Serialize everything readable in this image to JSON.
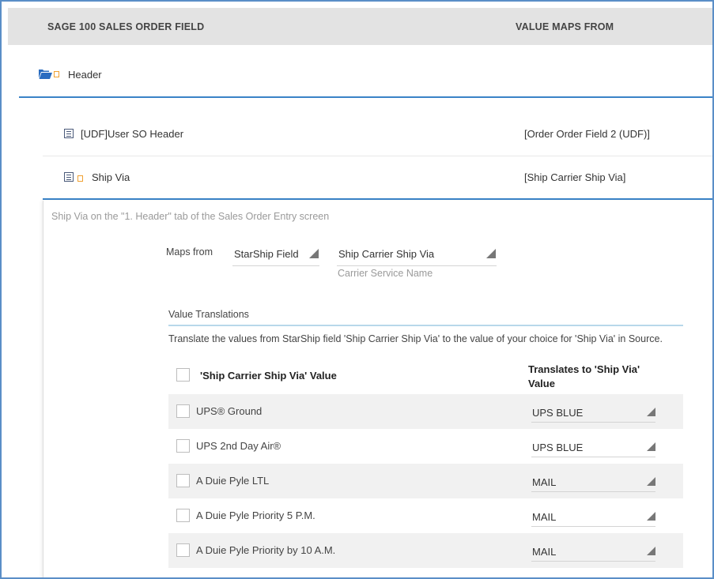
{
  "columns": {
    "field": "SAGE 100 SALES ORDER FIELD",
    "maps_from": "VALUE MAPS FROM"
  },
  "group": {
    "label": "Header",
    "icon": "folder-open-icon"
  },
  "fields": [
    {
      "label": "[UDF]User SO Header",
      "value": "[Order Order Field 2 (UDF)]",
      "icon": "list-icon"
    },
    {
      "label": "Ship Via",
      "value": "[Ship Carrier Ship Via]",
      "icon": "list-icon"
    }
  ],
  "detail": {
    "description": "Ship Via on the \"1. Header\" tab of the Sales Order Entry screen",
    "maps_from_label": "Maps from",
    "source_type": "StarShip Field",
    "source_field": "Ship Carrier Ship Via",
    "source_hint": "Carrier Service Name",
    "translations_title": "Value Translations",
    "translations_desc": "Translate the values from StarShip field 'Ship Carrier Ship Via' to the value of your choice for 'Ship Via' in Source.",
    "table_header": {
      "col1": "'Ship Carrier Ship Via' Value",
      "col2": "Translates to 'Ship Via' Value"
    },
    "rows": [
      {
        "name": "UPS® Ground",
        "value": "UPS BLUE"
      },
      {
        "name": "UPS 2nd Day Air®",
        "value": "UPS BLUE"
      },
      {
        "name": "A Duie Pyle LTL",
        "value": "MAIL"
      },
      {
        "name": "A Duie Pyle Priority 5 P.M.",
        "value": "MAIL"
      },
      {
        "name": "A Duie Pyle Priority by 10 A.M.",
        "value": "MAIL"
      }
    ]
  },
  "colors": {
    "accent": "#3a83c7",
    "frame": "#5a8ec7",
    "header_bg": "#e3e3e3",
    "row_shade": "#f1f1f1",
    "icon_orange": "#f0a030",
    "folder_blue": "#2a6cc0"
  }
}
